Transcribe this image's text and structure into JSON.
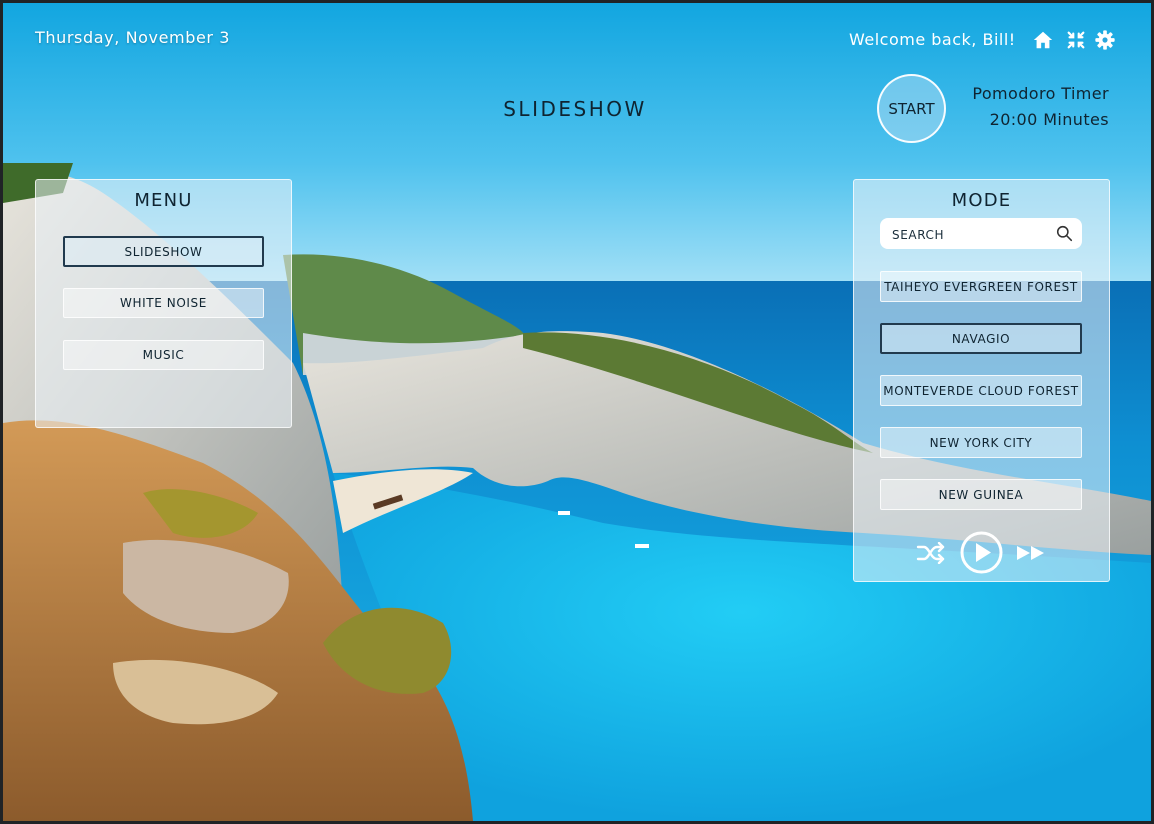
{
  "header": {
    "date": "Thursday, November 3",
    "welcome": "Welcome back, Bill!",
    "title": "SLIDESHOW",
    "icons": [
      "home-icon",
      "minimize-icon",
      "settings-icon"
    ]
  },
  "pomodoro": {
    "start_label": "START",
    "title": "Pomodoro Timer",
    "duration": "20:00 Minutes"
  },
  "menu": {
    "title": "MENU",
    "items": [
      {
        "label": "SLIDESHOW",
        "active": true
      },
      {
        "label": "WHITE NOISE",
        "active": false
      },
      {
        "label": "MUSIC",
        "active": false
      }
    ]
  },
  "mode": {
    "title": "MODE",
    "search_placeholder": "SEARCH",
    "items": [
      {
        "label": "TAIHEYO EVERGREEN FOREST",
        "active": false
      },
      {
        "label": "NAVAGIO",
        "active": true
      },
      {
        "label": "MONTEVERDE CLOUD FOREST",
        "active": false
      },
      {
        "label": "NEW YORK CITY",
        "active": false
      },
      {
        "label": "NEW GUINEA",
        "active": false
      }
    ],
    "controls": [
      "shuffle-icon",
      "play-icon",
      "fast-forward-icon"
    ]
  },
  "colors": {
    "text": "#0f2431",
    "active_border": "#213a4e",
    "sky": "#29b3e6",
    "sea": "#12b7ea"
  }
}
